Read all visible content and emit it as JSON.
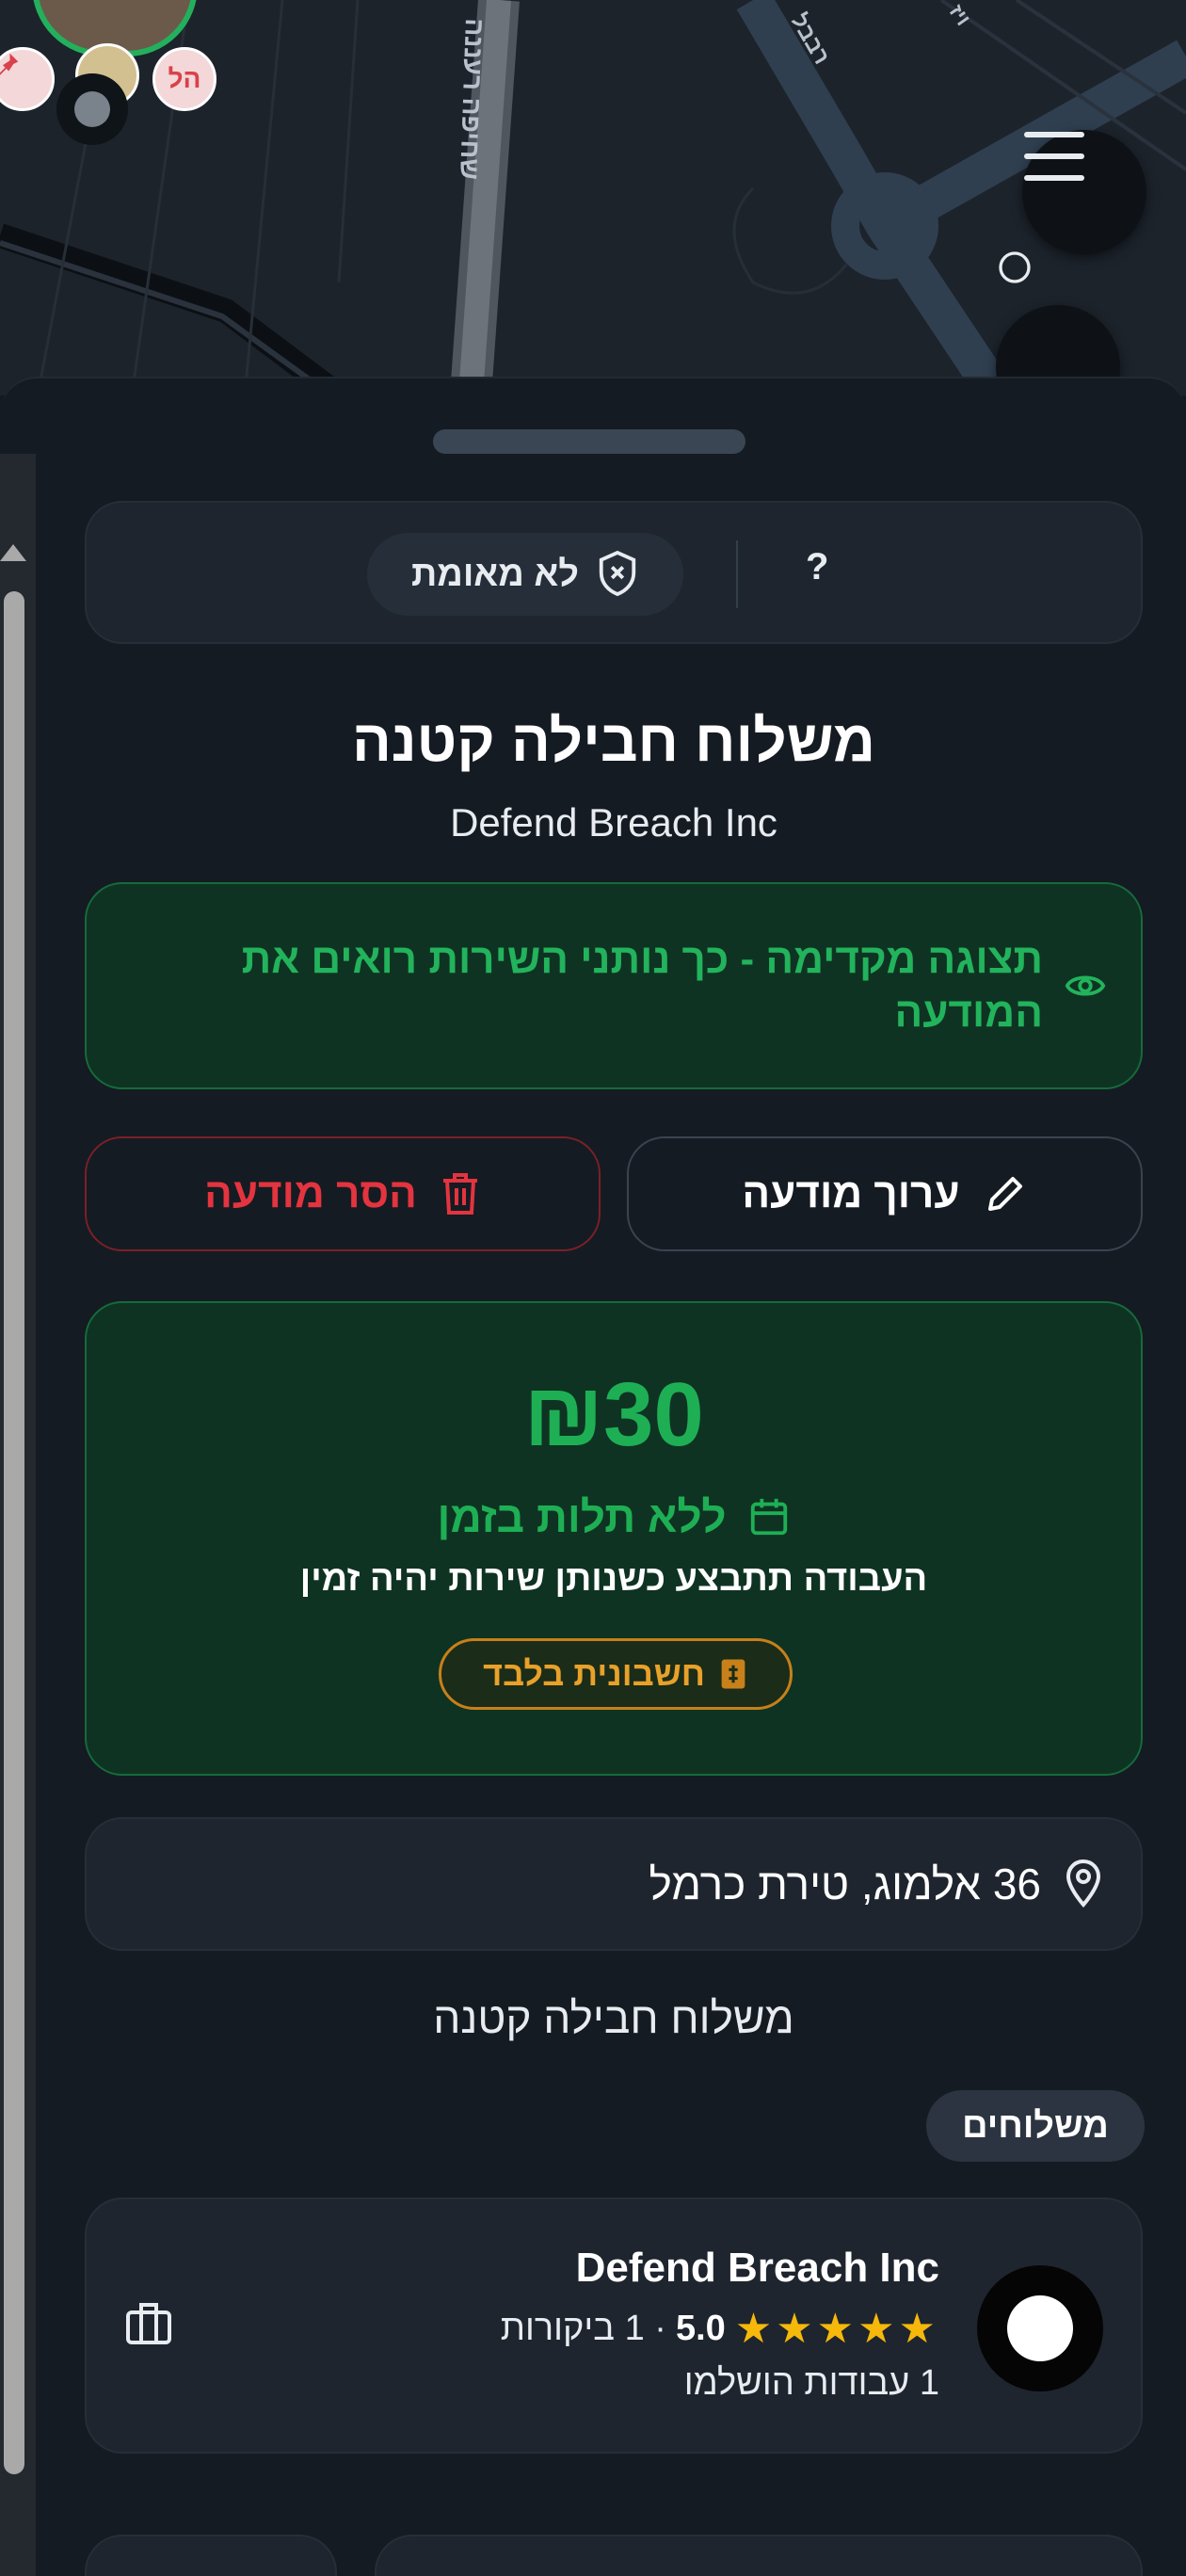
{
  "map": {
    "street_label_1": "שחיפה רעננה",
    "street_label_2": "רבבל",
    "street_label_3": "ויז",
    "pin_label": "הל"
  },
  "verify": {
    "status_label": "לא מאומת",
    "help_label": "?"
  },
  "listing": {
    "title": "משלוח חבילה קטנה",
    "owner": "Defend Breach Inc",
    "preview_note": "תצוגה מקדימה - כך נותני השירות רואים את המודעה",
    "edit_label": "ערוך מודעה",
    "remove_label": "הסר מודעה",
    "price": "₪30",
    "timing_label": "ללא תלות בזמן",
    "timing_desc": "העבודה תתבצע כשנותן שירות יהיה זמין",
    "invoice_label": "חשבונית בלבד",
    "address": "36 אלמוג, טירת כרמל",
    "description": "משלוח חבילה קטנה",
    "category_tag": "משלוחים"
  },
  "provider": {
    "name": "Defend Breach Inc",
    "stars": "★★★★★",
    "rating": "5.0",
    "reviews": "· 1 ביקורות",
    "jobs": "1 עבודות הושלמו"
  },
  "colors": {
    "accent_green": "#1eaf55",
    "danger_red": "#e3343f",
    "warning_orange": "#e8a12a",
    "star_yellow": "#f5b80b"
  }
}
